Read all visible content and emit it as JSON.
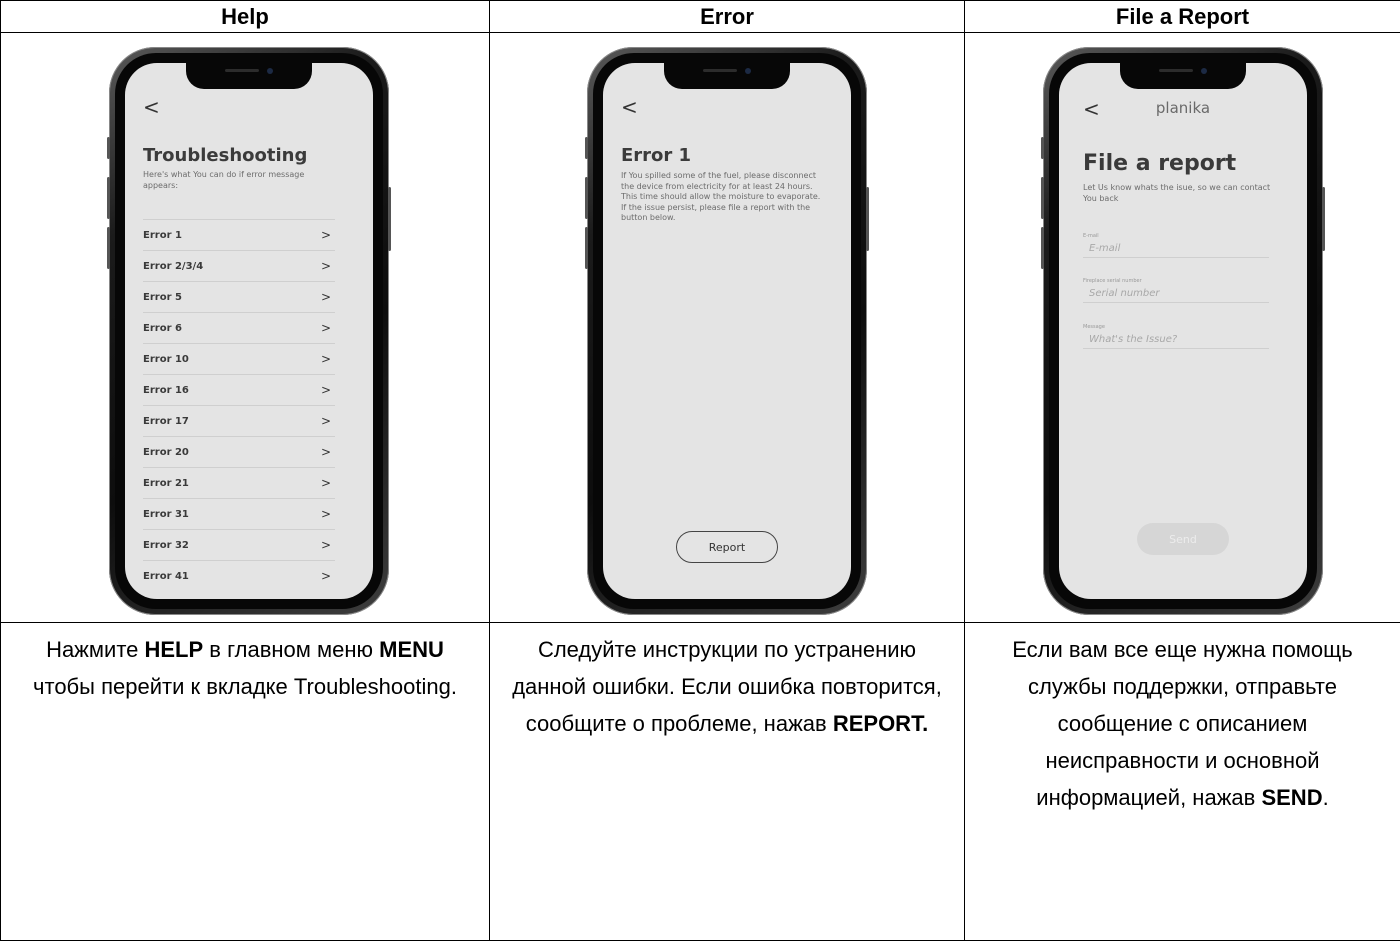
{
  "headers": [
    "Help",
    "Error",
    "File a Report"
  ],
  "help_screen": {
    "title": "Troubleshooting",
    "subtitle": "Here's what You can do if error message appears:",
    "items": [
      "Error 1",
      "Error 2/3/4",
      "Error 5",
      "Error 6",
      "Error 10",
      "Error 16",
      "Error 17",
      "Error 20",
      "Error 21",
      "Error 31",
      "Error 32",
      "Error 41"
    ],
    "chevron": ">",
    "back": "<"
  },
  "error_screen": {
    "title": "Error 1",
    "body": "If You spilled some of the fuel, please disconnect the device from electricity for at least 24 hours. This time should allow the moisture to evaporate. If the issue persist, please file a report with the button below.",
    "button": "Report",
    "back": "<"
  },
  "report_screen": {
    "brand": "planika",
    "title": "File a report",
    "subtitle": "Let Us know whats the isue, so we can contact You back",
    "fields": [
      {
        "label": "E-mail",
        "placeholder": "E-mail"
      },
      {
        "label": "Fireplace serial number",
        "placeholder": "Serial number"
      },
      {
        "label": "Message",
        "placeholder": "What's the Issue?"
      }
    ],
    "button": "Send",
    "back": "<"
  },
  "descriptions": {
    "help": {
      "p1": "Нажмите ",
      "b1": "HELP",
      "p2": " в главном меню ",
      "b2": "MENU",
      "p3": " чтобы перейти к вкладке Troubleshooting."
    },
    "error": {
      "p1": "Следуйте инструкции по устранению данной ошибки. Если ошибка повторится, сообщите о проблеме, нажав ",
      "b1": "REPORT."
    },
    "report": {
      "p1": "Если вам все еще нужна помощь службы поддержки, отправьте сообщение с описанием неисправности и основной информацией, нажав ",
      "b1": "SEND",
      "p2": "."
    }
  }
}
